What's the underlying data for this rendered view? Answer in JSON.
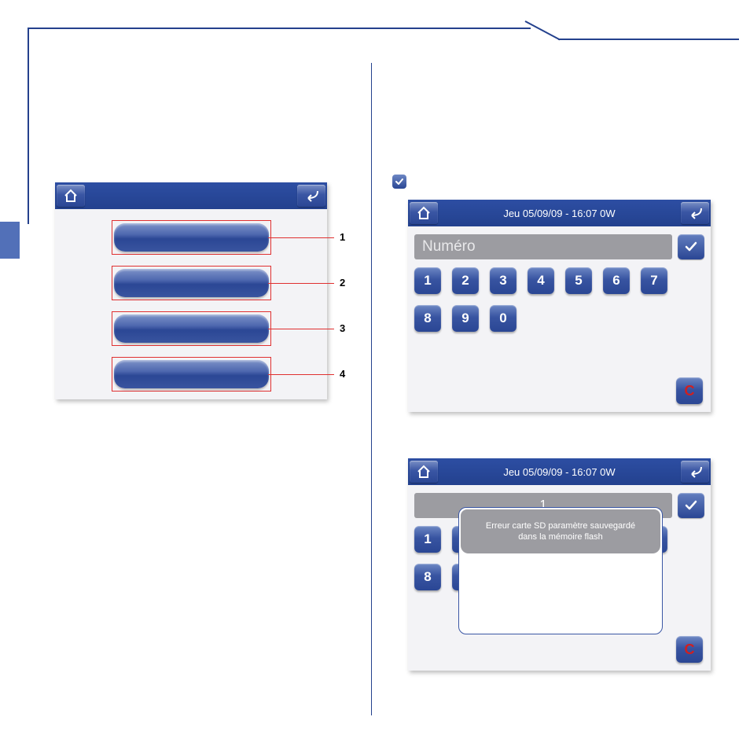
{
  "title_date": "Jeu 05/09/09 - 16:07   0W",
  "numero_placeholder": "Numéro",
  "keys": [
    "1",
    "2",
    "3",
    "4",
    "5",
    "6",
    "7",
    "8",
    "9",
    "0"
  ],
  "clear_label": "C",
  "leaders": [
    "1",
    "2",
    "3",
    "4"
  ],
  "entered_value": "1",
  "error_line1": "Erreur carte SD paramètre sauvegardé",
  "error_line2": "dans la mémoire flash"
}
